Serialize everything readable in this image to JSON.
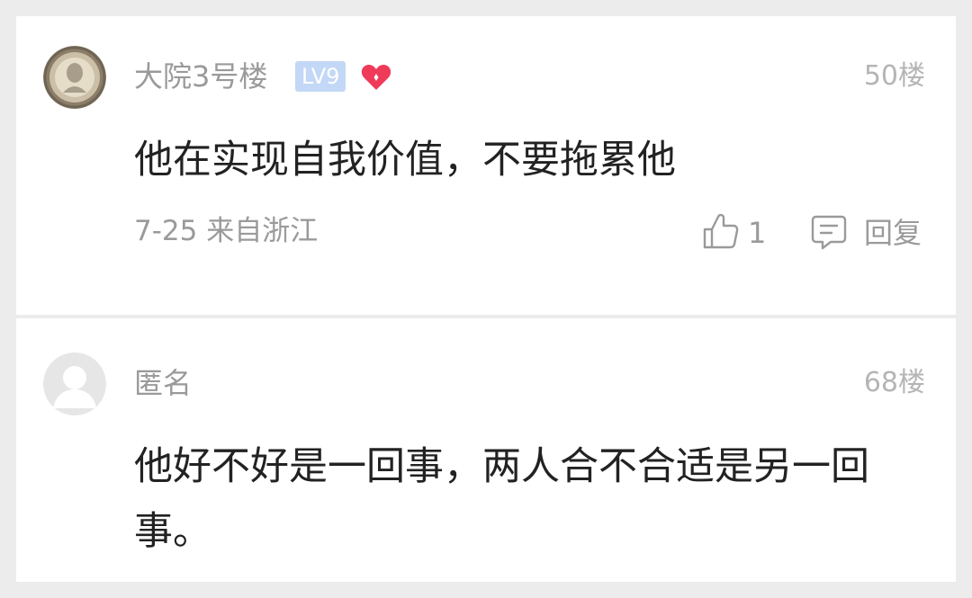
{
  "comments": [
    {
      "username": "大院3号楼",
      "level": "LV9",
      "floor": "50楼",
      "content": "他在实现自我价值，不要拖累他",
      "date": "7-25",
      "location": "来自浙江",
      "like_count": "1",
      "reply_label": "回复"
    },
    {
      "username": "匿名",
      "floor": "68楼",
      "content": "他好不好是一回事，两人合不合适是另一回事。"
    }
  ],
  "colors": {
    "background": "#ececec",
    "card": "#ffffff",
    "username": "#9a9a9a",
    "content": "#222222",
    "level_badge": "#c3d8f6",
    "heart": "#ef3b5a"
  },
  "icons": [
    "avatar",
    "heart-icon",
    "thumbs-up-icon",
    "comment-bubble-icon"
  ]
}
